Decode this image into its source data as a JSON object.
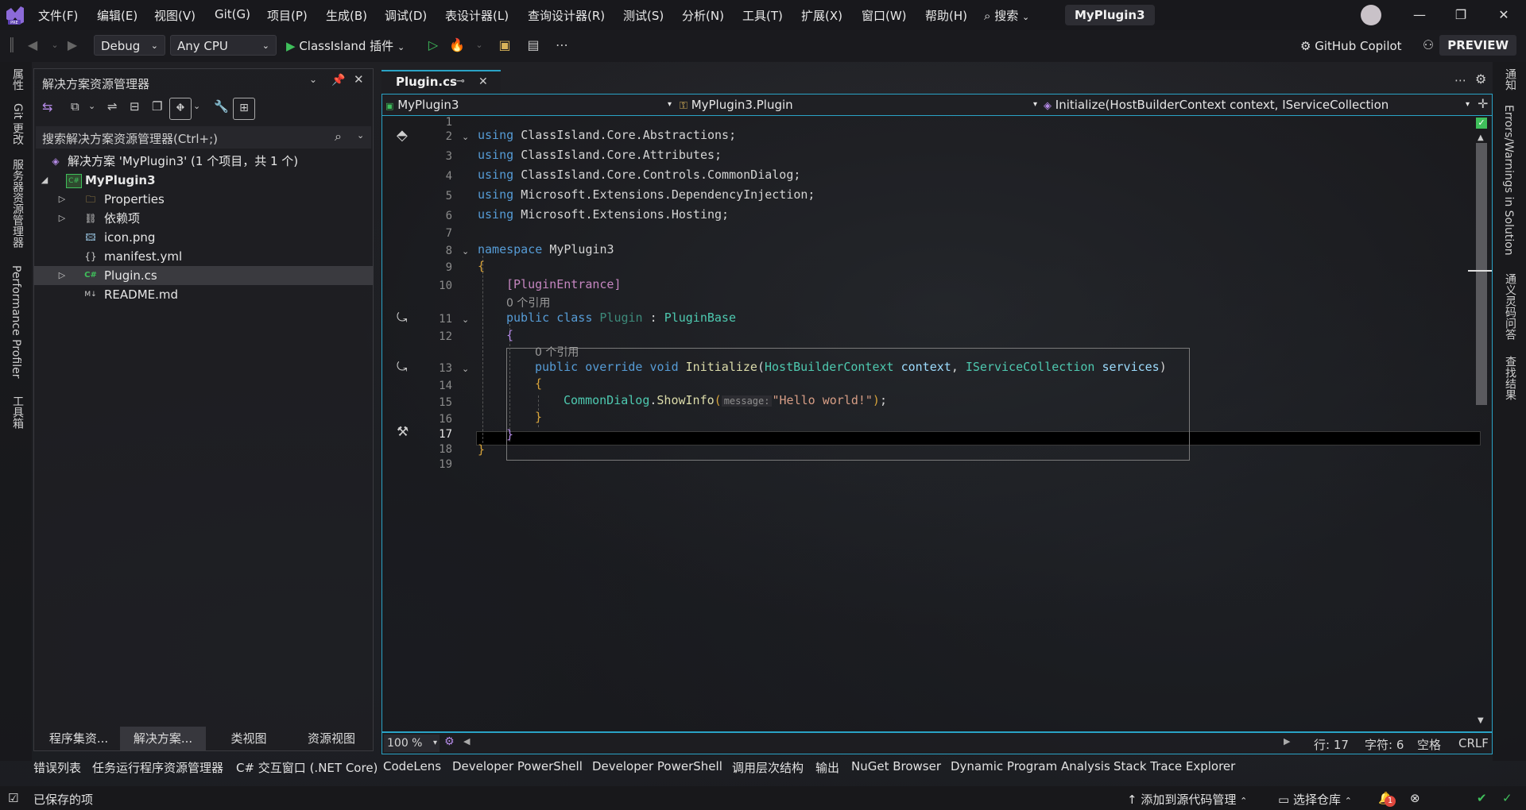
{
  "menu": [
    "文件(F)",
    "编辑(E)",
    "视图(V)",
    "Git(G)",
    "项目(P)",
    "生成(B)",
    "调试(D)",
    "表设计器(L)",
    "查询设计器(R)",
    "测试(S)",
    "分析(N)",
    "工具(T)",
    "扩展(X)",
    "窗口(W)",
    "帮助(H)"
  ],
  "search_label": "搜索",
  "project_name": "MyPlugin3",
  "toolbar": {
    "config": "Debug",
    "platform": "Any CPU",
    "run_target": "ClassIsland 插件",
    "copilot": "GitHub Copilot",
    "preview": "PREVIEW"
  },
  "left_vtabs": [
    "属性",
    "Git 更改",
    "服务器资源管理器",
    "Performance Profiler",
    "工具箱"
  ],
  "right_vtabs": [
    "通知",
    "Errors/Warnings in Solution",
    "通义灵码问答",
    "查找结果"
  ],
  "solution_explorer": {
    "title": "解决方案资源管理器",
    "search_placeholder": "搜索解决方案资源管理器(Ctrl+;)",
    "tree": [
      {
        "label": "解决方案 'MyPlugin3' (1 个项目，共 1 个)",
        "icon": "solution-icon"
      },
      {
        "label": "MyPlugin3",
        "icon": "csharp-project-icon"
      },
      {
        "label": "Properties",
        "icon": "properties-folder-icon"
      },
      {
        "label": "依赖项",
        "icon": "dependencies-icon"
      },
      {
        "label": "icon.png",
        "icon": "image-file-icon"
      },
      {
        "label": "manifest.yml",
        "icon": "yaml-file-icon"
      },
      {
        "label": "Plugin.cs",
        "icon": "csharp-file-icon"
      },
      {
        "label": "README.md",
        "icon": "markdown-file-icon"
      }
    ],
    "bottom_tabs": [
      "程序集资...",
      "解决方案...",
      "类视图",
      "资源视图"
    ]
  },
  "editor": {
    "tab_label": "Plugin.cs",
    "nav_project": "MyPlugin3",
    "nav_class": "MyPlugin3.Plugin",
    "nav_member": "Initialize(HostBuilderContext context, IServiceCollection",
    "line_numbers": [
      "1",
      "2",
      "3",
      "4",
      "5",
      "6",
      "7",
      "8",
      "9",
      "10",
      "11",
      "12",
      "13",
      "14",
      "15",
      "16",
      "17",
      "18",
      "19"
    ],
    "usings": [
      "ClassIsland.Core.Abstractions;",
      "ClassIsland.Core.Attributes;",
      "ClassIsland.Core.Controls.CommonDialog;",
      "Microsoft.Extensions.DependencyInjection;",
      "Microsoft.Extensions.Hosting;"
    ],
    "kw_using": "using",
    "kw_namespace": "namespace",
    "namespace_name": "MyPlugin3",
    "open_brace": "{",
    "close_brace": "}",
    "attribute": "[PluginEntrance]",
    "ref_count_1": "0 个引用",
    "ref_count_2": "0 个引用",
    "class_decl": {
      "kw": "public class",
      "name": "Plugin",
      "sep": " : ",
      "base": "PluginBase"
    },
    "method_decl": {
      "kw": "public override void",
      "name": "Initialize",
      "p1_type": "HostBuilderContext",
      "p1": "context",
      "p2_type": "IServiceCollection",
      "p2": "services"
    },
    "call": {
      "obj": "CommonDialog",
      "method": "ShowInfo",
      "hint": "message:",
      "arg": "\"Hello world!\""
    },
    "zoom": "100 %",
    "status": {
      "line": "行: 17",
      "char": "字符: 6",
      "spaces": "空格",
      "eol": "CRLF"
    }
  },
  "tool_tabs": [
    "错误列表",
    "任务运行程序资源管理器",
    "C# 交互窗口 (.NET Core)",
    "CodeLens",
    "Developer PowerShell",
    "Developer PowerShell",
    "调用层次结构",
    "输出",
    "NuGet Browser",
    "Dynamic Program Analysis",
    "Stack Trace Explorer"
  ],
  "statusbar": {
    "left": "已保存的项",
    "add_source": "添加到源代码管理",
    "select_repo": "选择仓库",
    "notif_count": "1"
  },
  "colors": {
    "accent": "#2aa3c6",
    "keyword": "#569cd6",
    "type": "#4ec9b0",
    "method": "#dcdcaa",
    "string": "#d69d85",
    "attribute": "#c586c0"
  }
}
